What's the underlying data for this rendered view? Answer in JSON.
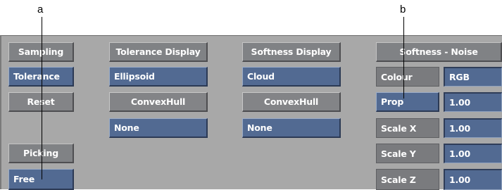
{
  "callouts": {
    "a": "a",
    "b": "b"
  },
  "columns": {
    "sampling": {
      "header": "Sampling",
      "tolerance": "Tolerance",
      "reset": "Reset",
      "picking": "Picking",
      "free": "Free"
    },
    "tolerance_display": {
      "header": "Tolerance Display",
      "ellipsoid": "Ellipsoid",
      "convexhull": "ConvexHull",
      "none": "None"
    },
    "softness_display": {
      "header": "Softness Display",
      "cloud": "Cloud",
      "convexhull": "ConvexHull",
      "none": "None"
    },
    "softness_noise": {
      "header": "Softness - Noise",
      "colour_label": "Colour",
      "colour_value": "RGB",
      "prop_label": "Prop",
      "prop_value": "1.00",
      "scale_x_label": "Scale X",
      "scale_x_value": "1.00",
      "scale_y_label": "Scale Y",
      "scale_y_value": "1.00",
      "scale_z_label": "Scale Z",
      "scale_z_value": "1.00"
    }
  },
  "colors": {
    "panel": "#a8a8a8",
    "button_blue": "#526a92",
    "button_gray": "#838487",
    "header": "#808285"
  }
}
